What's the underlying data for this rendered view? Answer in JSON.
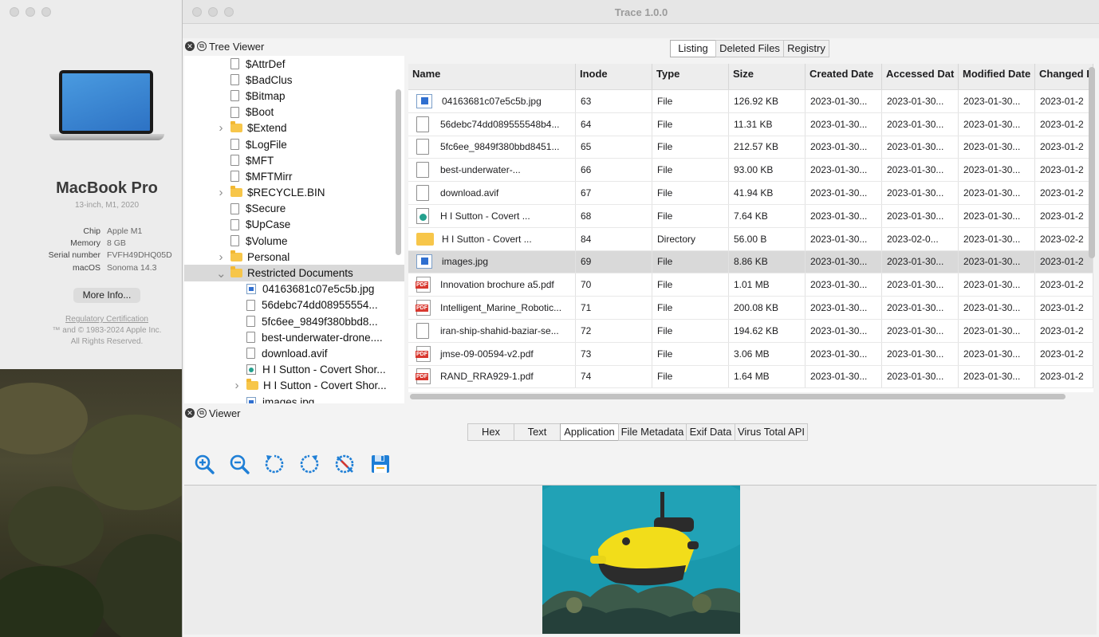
{
  "about": {
    "title": "MacBook Pro",
    "subtitle": "13-inch, M1, 2020",
    "specs": [
      {
        "key": "Chip",
        "value": "Apple M1"
      },
      {
        "key": "Memory",
        "value": "8 GB"
      },
      {
        "key": "Serial number",
        "value": "FVFH49DHQ05D"
      },
      {
        "key": "macOS",
        "value": "Sonoma 14.3"
      }
    ],
    "more_info": "More Info...",
    "regulatory": "Regulatory Certification",
    "copyright": "™ and © 1983-2024 Apple Inc.",
    "rights": "All Rights Reserved."
  },
  "trace": {
    "title": "Trace 1.0.0",
    "tree_viewer_label": "Tree Viewer",
    "viewer_label": "Viewer",
    "tree": [
      {
        "label": "$AttrDef",
        "icon": "doc",
        "depth": 1,
        "expandable": false
      },
      {
        "label": "$BadClus",
        "icon": "doc",
        "depth": 1,
        "expandable": false
      },
      {
        "label": "$Bitmap",
        "icon": "doc",
        "depth": 1,
        "expandable": false
      },
      {
        "label": "$Boot",
        "icon": "doc",
        "depth": 1,
        "expandable": false
      },
      {
        "label": "$Extend",
        "icon": "folder",
        "depth": 1,
        "expandable": true
      },
      {
        "label": "$LogFile",
        "icon": "doc",
        "depth": 1,
        "expandable": false
      },
      {
        "label": "$MFT",
        "icon": "doc",
        "depth": 1,
        "expandable": false
      },
      {
        "label": "$MFTMirr",
        "icon": "doc",
        "depth": 1,
        "expandable": false
      },
      {
        "label": "$RECYCLE.BIN",
        "icon": "folder",
        "depth": 1,
        "expandable": true
      },
      {
        "label": "$Secure",
        "icon": "doc",
        "depth": 1,
        "expandable": false
      },
      {
        "label": "$UpCase",
        "icon": "doc",
        "depth": 1,
        "expandable": false
      },
      {
        "label": "$Volume",
        "icon": "doc",
        "depth": 1,
        "expandable": false
      },
      {
        "label": "Personal",
        "icon": "folder",
        "depth": 1,
        "expandable": true
      },
      {
        "label": "Restricted Documents",
        "icon": "folder",
        "depth": 1,
        "expandable": true,
        "expanded": true,
        "selected": true
      },
      {
        "label": "04163681c07e5c5b.jpg",
        "icon": "img",
        "depth": 2,
        "expandable": false
      },
      {
        "label": "56debc74dd08955554...",
        "icon": "doc",
        "depth": 2,
        "expandable": false
      },
      {
        "label": "5fc6ee_9849f380bbd8...",
        "icon": "doc",
        "depth": 2,
        "expandable": false
      },
      {
        "label": "best-underwater-drone....",
        "icon": "doc",
        "depth": 2,
        "expandable": false
      },
      {
        "label": "download.avif",
        "icon": "doc",
        "depth": 2,
        "expandable": false
      },
      {
        "label": "H I Sutton - Covert Shor...",
        "icon": "web",
        "depth": 2,
        "expandable": false
      },
      {
        "label": "H I Sutton - Covert Shor...",
        "icon": "folder",
        "depth": 2,
        "expandable": true
      },
      {
        "label": "images.jpg",
        "icon": "img",
        "depth": 2,
        "expandable": false
      }
    ],
    "listing_tabs": [
      "Listing",
      "Deleted Files",
      "Registry"
    ],
    "listing_active": 0,
    "columns": [
      "Name",
      "Inode",
      "Type",
      "Size",
      "Created Date",
      "Accessed Dat",
      "Modified Date",
      "Changed D"
    ],
    "rows": [
      {
        "icon": "img",
        "name": "04163681c07e5c5b.jpg",
        "inode": "63",
        "type": "File",
        "size": "126.92 KB",
        "created": "2023-01-30...",
        "accessed": "2023-01-30...",
        "modified": "2023-01-30...",
        "changed": "2023-01-2"
      },
      {
        "icon": "doc",
        "name": "56debc74dd089555548b4...",
        "inode": "64",
        "type": "File",
        "size": "11.31 KB",
        "created": "2023-01-30...",
        "accessed": "2023-01-30...",
        "modified": "2023-01-30...",
        "changed": "2023-01-2"
      },
      {
        "icon": "doc",
        "name": "5fc6ee_9849f380bbd8451...",
        "inode": "65",
        "type": "File",
        "size": "212.57 KB",
        "created": "2023-01-30...",
        "accessed": "2023-01-30...",
        "modified": "2023-01-30...",
        "changed": "2023-01-2"
      },
      {
        "icon": "doc",
        "name": "best-underwater-...",
        "inode": "66",
        "type": "File",
        "size": "93.00 KB",
        "created": "2023-01-30...",
        "accessed": "2023-01-30...",
        "modified": "2023-01-30...",
        "changed": "2023-01-2"
      },
      {
        "icon": "doc",
        "name": "download.avif",
        "inode": "67",
        "type": "File",
        "size": "41.94 KB",
        "created": "2023-01-30...",
        "accessed": "2023-01-30...",
        "modified": "2023-01-30...",
        "changed": "2023-01-2"
      },
      {
        "icon": "web",
        "name": "H I Sutton - Covert ...",
        "inode": "68",
        "type": "File",
        "size": "7.64 KB",
        "created": "2023-01-30...",
        "accessed": "2023-01-30...",
        "modified": "2023-01-30...",
        "changed": "2023-01-2"
      },
      {
        "icon": "folder",
        "name": "H I Sutton - Covert ...",
        "inode": "84",
        "type": "Directory",
        "size": "56.00 B",
        "created": "2023-01-30...",
        "accessed": "2023-02-0...",
        "modified": "2023-01-30...",
        "changed": "2023-02-2"
      },
      {
        "icon": "img",
        "name": "images.jpg",
        "inode": "69",
        "type": "File",
        "size": "8.86 KB",
        "created": "2023-01-30...",
        "accessed": "2023-01-30...",
        "modified": "2023-01-30...",
        "changed": "2023-01-2",
        "selected": true
      },
      {
        "icon": "pdf",
        "name": "Innovation brochure a5.pdf",
        "inode": "70",
        "type": "File",
        "size": "1.01 MB",
        "created": "2023-01-30...",
        "accessed": "2023-01-30...",
        "modified": "2023-01-30...",
        "changed": "2023-01-2"
      },
      {
        "icon": "pdf",
        "name": "Intelligent_Marine_Robotic...",
        "inode": "71",
        "type": "File",
        "size": "200.08 KB",
        "created": "2023-01-30...",
        "accessed": "2023-01-30...",
        "modified": "2023-01-30...",
        "changed": "2023-01-2"
      },
      {
        "icon": "doc",
        "name": "iran-ship-shahid-baziar-se...",
        "inode": "72",
        "type": "File",
        "size": "194.62 KB",
        "created": "2023-01-30...",
        "accessed": "2023-01-30...",
        "modified": "2023-01-30...",
        "changed": "2023-01-2"
      },
      {
        "icon": "pdf",
        "name": "jmse-09-00594-v2.pdf",
        "inode": "73",
        "type": "File",
        "size": "3.06 MB",
        "created": "2023-01-30...",
        "accessed": "2023-01-30...",
        "modified": "2023-01-30...",
        "changed": "2023-01-2"
      },
      {
        "icon": "pdf",
        "name": "RAND_RRA929-1.pdf",
        "inode": "74",
        "type": "File",
        "size": "1.64 MB",
        "created": "2023-01-30...",
        "accessed": "2023-01-30...",
        "modified": "2023-01-30...",
        "changed": "2023-01-2"
      }
    ],
    "viewer_tabs": [
      "Hex",
      "Text",
      "Application",
      "File Metadata",
      "Exif Data",
      "Virus Total API"
    ],
    "viewer_active": 2,
    "viewer_tools": [
      "zoom-in-icon",
      "zoom-out-icon",
      "rotate-left-icon",
      "rotate-right-icon",
      "reset-icon",
      "save-icon"
    ],
    "colors": {
      "accent": "#1f7fd6",
      "selection": "#d9d9d9",
      "folder": "#f7c64a",
      "pdf": "#d8382f"
    }
  }
}
